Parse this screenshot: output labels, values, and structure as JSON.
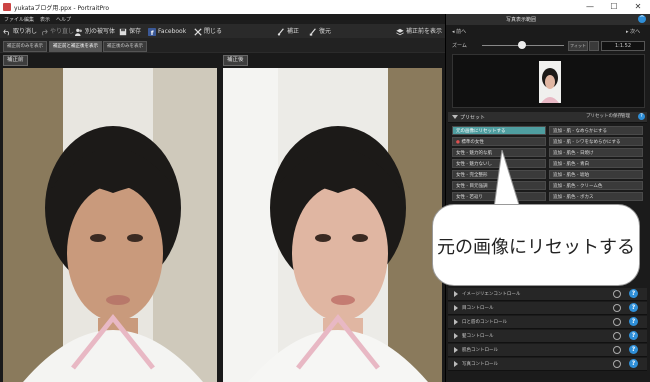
{
  "window": {
    "title": "yukataブログ用.ppx - PortraitPro",
    "controls": {
      "minimize": "—",
      "maximize": "☐",
      "close": "✕"
    }
  },
  "menu": [
    "ファイル",
    "編集",
    "表示",
    "ヘルプ"
  ],
  "toolbar": {
    "undo": "取り消し",
    "redo": "やり直し",
    "another": "別の被写体",
    "save": "保存",
    "facebook": "Facebook",
    "close": "閉じる",
    "correct": "補正",
    "restore": "復元",
    "show_before": "補正前を表示"
  },
  "view_tabs": [
    "補正前のみを表示",
    "補正前と補正後を表示",
    "補正後のみを表示"
  ],
  "panes": {
    "before_label": "補正前",
    "after_label": "補正後"
  },
  "right_panel": {
    "navigator": {
      "title": "写真表示範囲",
      "prev": "前へ",
      "next": "次へ",
      "zoom_label": "ズーム",
      "fit": "フィット",
      "zoom_value": "1:1.52"
    },
    "presets": {
      "title": "プリセット",
      "save_btn": "プリセットの保存",
      "manage_btn": "管理",
      "left": [
        "元の画像にリセットする",
        "標準の女性",
        "女性 - 魅力的な肌",
        "女性 - 魅力ないし",
        "女性 - 完全整形",
        "女性 - 目元強調",
        "女性 - 若返り"
      ],
      "right": [
        "追加 - 肌 - なめらかにする",
        "追加 - 肌 - シワをなめらかにする",
        "追加 - 肌色 - 日焼け",
        "追加 - 肌色 - 青白",
        "追加 - 肌色 - 琥珀",
        "追加 - 肌色 - クリーム色",
        "追加 - 肌色 - ボカス"
      ]
    },
    "controls": [
      "イメージリエンコントロール",
      "目コントロール",
      "口と唇のコントロール",
      "髪コントロール",
      "肌色コントロール",
      "写真コントロール"
    ]
  },
  "callout": {
    "text": "元の画像にリセットする"
  }
}
